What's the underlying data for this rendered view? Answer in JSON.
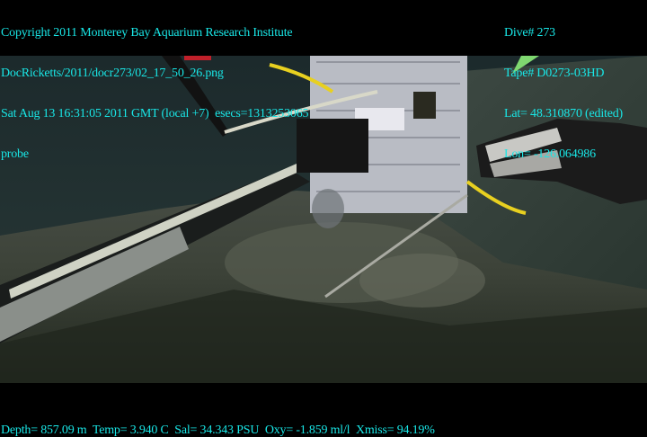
{
  "overlay_top_left": [
    "Copyright 2011 Monterey Bay Aquarium Research Institute",
    "DocRicketts/2011/docr273/02_17_50_26.png",
    "Sat Aug 13 16:31:05 2011 GMT (local +7)  esecs=1313253065",
    "probe"
  ],
  "overlay_top_right": [
    "Dive# 273",
    "Tape# D0273-03HD",
    "Lat= 48.310870 (edited)",
    "Lon= -126.064986"
  ],
  "overlay_bottom": "Depth= 857.09 m  Temp= 3.940 C  Sal= 34.343 PSU  Oxy= -1.859 ml/l  Xmiss= 94.19%",
  "colors": {
    "overlay_text": "#19e6e6",
    "background": "#000000"
  }
}
